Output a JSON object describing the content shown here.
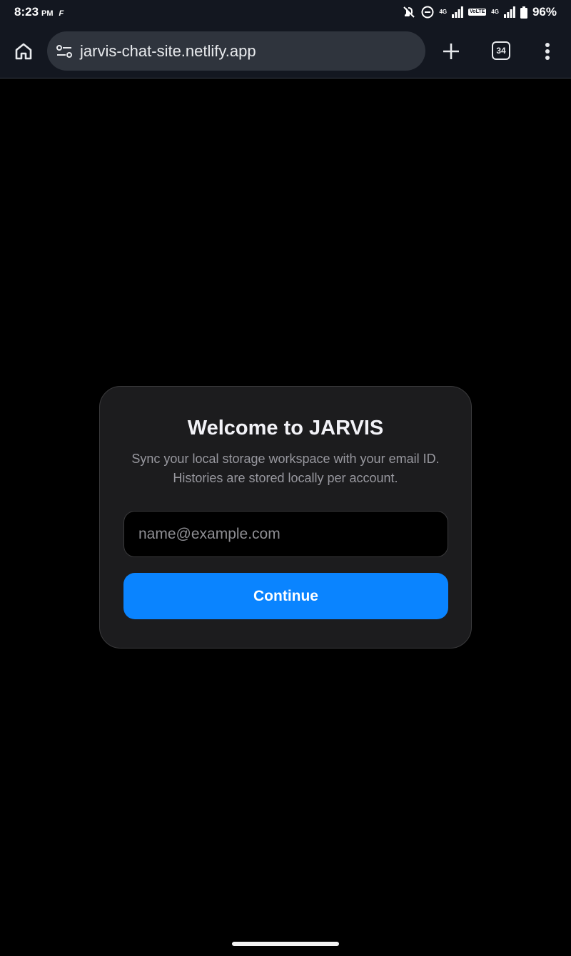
{
  "status_bar": {
    "time": "8:23",
    "ampm": "PM",
    "app_indicator": "F",
    "network_1": "4G",
    "volte": "VoLTE",
    "network_2": "4G",
    "battery": "96%",
    "icons": [
      "mute-icon",
      "dnd-icon",
      "signal-icon",
      "battery-icon"
    ]
  },
  "browser": {
    "url": "jarvis-chat-site.netlify.app",
    "tab_count": "34",
    "icons": [
      "home-icon",
      "site-settings-icon",
      "plus-icon",
      "more-vert-icon"
    ]
  },
  "login": {
    "title": "Welcome to JARVIS",
    "description": "Sync your local storage workspace with your email ID. Histories are stored locally per account.",
    "email_value": "",
    "email_placeholder": "name@example.com",
    "continue_label": "Continue"
  },
  "colors": {
    "background": "#000000",
    "chrome": "#131720",
    "card": "#1c1c1e",
    "accent": "#0a84ff"
  }
}
